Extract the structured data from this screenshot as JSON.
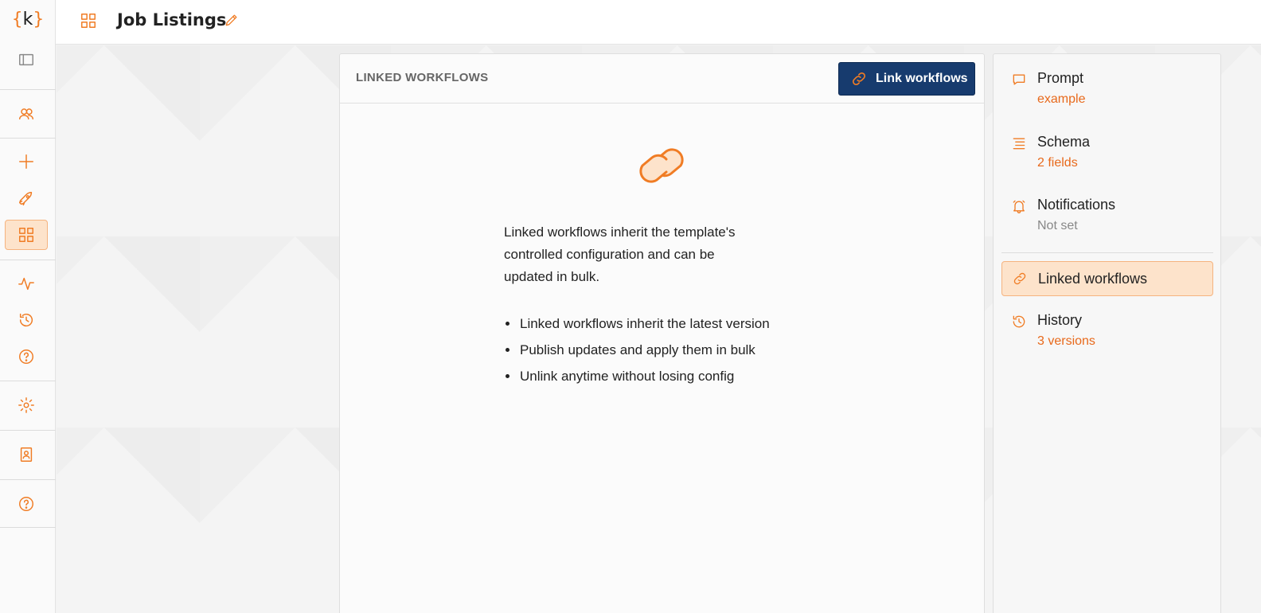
{
  "app": {
    "logo_open": "{",
    "logo_letter": "k",
    "logo_close": "}"
  },
  "header": {
    "title": "Job Listings"
  },
  "panel": {
    "title": "LINKED WORKFLOWS",
    "link_button_label": "Link workflows",
    "description": "Linked workflows inherit the template's controlled configuration and can be updated in bulk.",
    "bullets": [
      "Linked workflows inherit the latest version",
      "Publish updates and apply them in bulk",
      "Unlink anytime without losing config"
    ]
  },
  "side": {
    "items": [
      {
        "label": "Prompt",
        "sub": "example",
        "icon": "chat-icon"
      },
      {
        "label": "Schema",
        "sub": "2 fields",
        "icon": "schema-icon"
      },
      {
        "label": "Notifications",
        "sub": "Not set",
        "icon": "bell-icon"
      },
      {
        "label": "Linked workflows",
        "sub": "",
        "icon": "link-icon"
      },
      {
        "label": "History",
        "sub": "3 versions",
        "icon": "history-icon"
      }
    ]
  },
  "colors": {
    "accent": "#f07c24",
    "primary_button": "#173b6e",
    "active_bg": "#fde3cb"
  }
}
